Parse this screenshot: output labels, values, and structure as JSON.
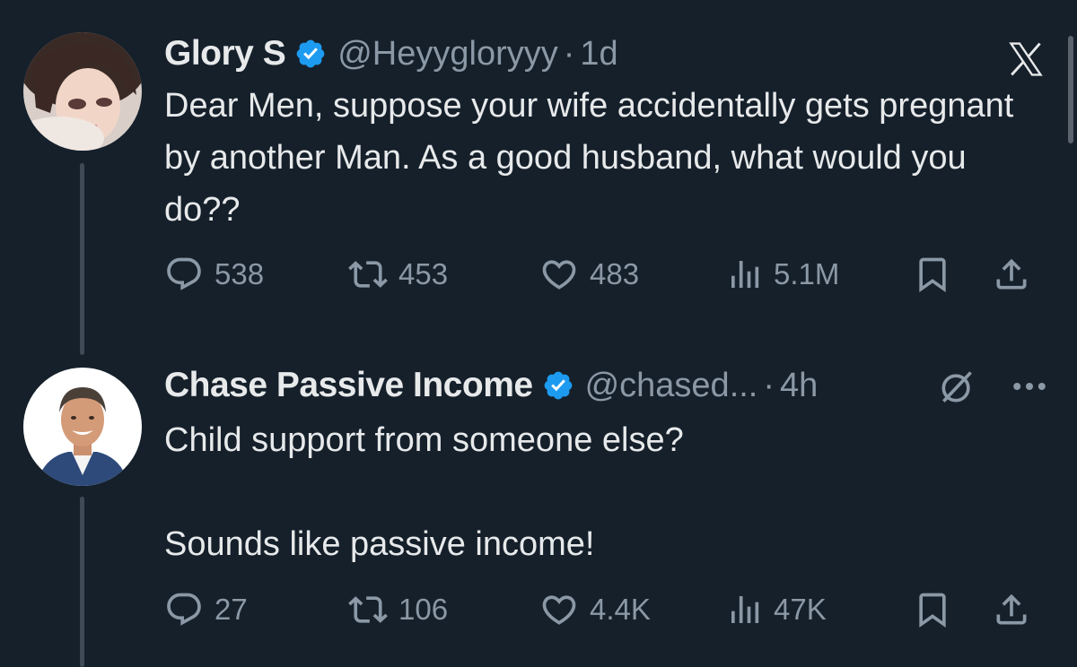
{
  "tweets": [
    {
      "author_name": "Glory S",
      "handle": "@Heyygloryyy",
      "separator": "·",
      "time": "1d",
      "text": "Dear Men, suppose your wife accidentally gets pregnant by another Man. As a good husband, what would you do??",
      "replies": "538",
      "retweets": "453",
      "likes": "483",
      "views": "5.1M"
    },
    {
      "author_name": "Chase Passive Income",
      "handle": "@chased...",
      "separator": "·",
      "time": "4h",
      "text": "Child support from someone else?\n\nSounds like passive income!",
      "replies": "27",
      "retweets": "106",
      "likes": "4.4K",
      "views": "47K"
    }
  ],
  "icons": {
    "verified": "verified-badge-icon",
    "reply": "reply-icon",
    "retweet": "retweet-icon",
    "like": "heart-icon",
    "views": "views-icon",
    "bookmark": "bookmark-icon",
    "share": "share-icon",
    "brand": "x-logo-icon",
    "grok": "grok-icon",
    "more": "more-icon"
  },
  "colors": {
    "background": "#15202b",
    "text": "#e7e9ea",
    "secondary": "#8b98a5",
    "verified": "#1d9bf0"
  }
}
